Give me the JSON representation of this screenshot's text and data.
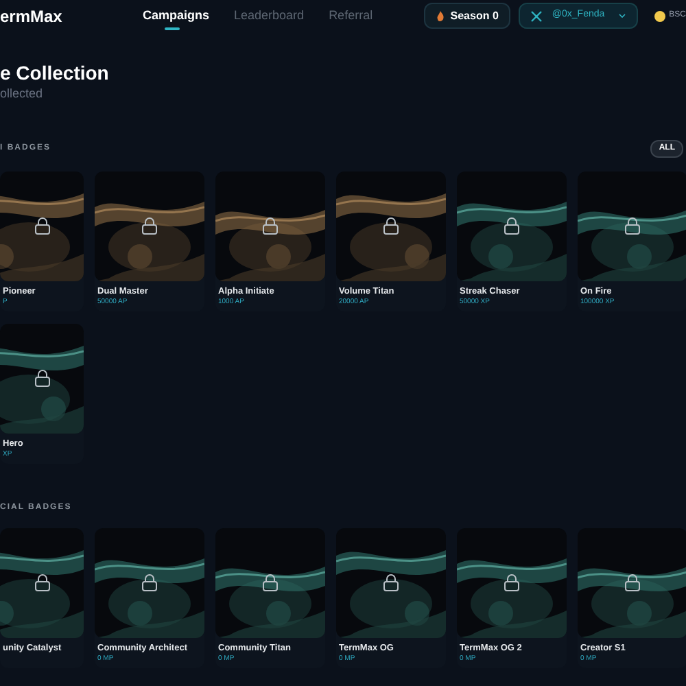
{
  "brand": "ermMax",
  "nav": [
    {
      "label": "Campaigns",
      "selected": true
    },
    {
      "label": "Leaderboard",
      "selected": false
    },
    {
      "label": "Referral",
      "selected": false
    }
  ],
  "season_button": "Season 0",
  "account_button": "@0x_Fenda",
  "network": "BSC",
  "title": "e Collection",
  "subtitle": "ollected",
  "sections": [
    {
      "heading": "I BADGES",
      "filter_button": "ALL",
      "badges": [
        {
          "name": "Pioneer",
          "points": "P",
          "locked": true
        },
        {
          "name": "Dual Master",
          "points": "50000 AP",
          "locked": true
        },
        {
          "name": "Alpha Initiate",
          "points": "1000 AP",
          "locked": true
        },
        {
          "name": "Volume Titan",
          "points": "20000 AP",
          "locked": true
        },
        {
          "name": "Streak Chaser",
          "points": "50000 XP",
          "locked": true
        },
        {
          "name": "On Fire",
          "points": "100000 XP",
          "locked": true
        },
        {
          "name": "Hero",
          "points": "XP",
          "locked": true
        }
      ]
    },
    {
      "heading": "CIAL BADGES",
      "badges": [
        {
          "name": "unity Catalyst",
          "locked": true
        },
        {
          "name": "Community Architect",
          "points": "0 MP",
          "locked": true
        },
        {
          "name": "Community Titan",
          "points": "0 MP",
          "locked": true
        },
        {
          "name": "TermMax OG",
          "points": "0 MP",
          "locked": true
        },
        {
          "name": "TermMax OG 2",
          "points": "0 MP",
          "locked": true
        },
        {
          "name": "Creator S1",
          "points": "0 MP",
          "locked": true
        }
      ]
    }
  ]
}
